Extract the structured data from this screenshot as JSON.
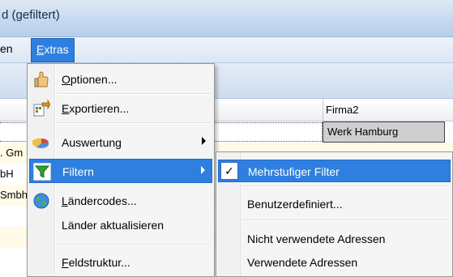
{
  "window": {
    "title": "d (gefiltert)"
  },
  "menubar": {
    "prev_item_label": "en",
    "extras_label": "Extras",
    "extras_access_key": "E",
    "extras_rest": "xtras"
  },
  "grid": {
    "header_firma2": "Firma2",
    "selected_cell": "Werk Hamburg",
    "row_fragments": [
      ". Gm",
      "bH",
      "Smbh"
    ]
  },
  "menu": {
    "items": [
      {
        "access": "O",
        "rest": "ptionen...",
        "icon": "options-hand-icon"
      },
      {
        "access": "E",
        "rest": "xportieren...",
        "icon": "export-icon"
      },
      {
        "label": "Auswertung",
        "icon": "pie-chart-icon",
        "submenu": true
      },
      {
        "label": "Filtern",
        "icon": "funnel-filter-icon",
        "submenu": true
      },
      {
        "access": "L",
        "rest": "ändercodes...",
        "icon": "globe-icon"
      },
      {
        "label": "Länder aktualisieren"
      },
      {
        "access": "F",
        "rest": "eldstruktur..."
      }
    ]
  },
  "submenu": {
    "items": [
      {
        "label": "Mehrstufiger Filter",
        "checked": true
      },
      {
        "label": "Benutzerdefiniert..."
      },
      {
        "label": "Nicht verwendete Adressen"
      },
      {
        "label": "Verwendete Adressen"
      }
    ]
  },
  "colors": {
    "highlight": "#2f7fe0",
    "selected_cell": "#cfcfcf",
    "row_yellow": "#fffbe6"
  }
}
